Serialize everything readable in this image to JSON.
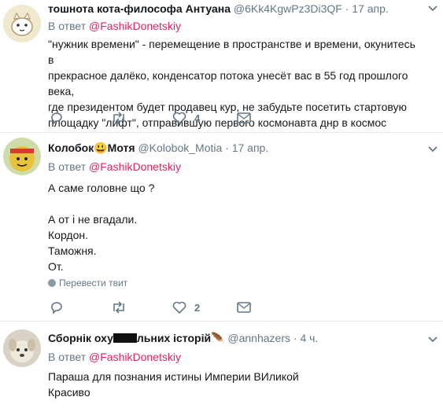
{
  "tweets": [
    {
      "name": "тошнота кота-философа Антуана",
      "handle": "@6Kk4KgwPz3Di3QF",
      "time": "17 апр.",
      "reply_prefix": "В ответ",
      "reply_mention": "@FashikDonetskiy",
      "text": "\"нужник времени\" - перемещение в пространстве и времени, окунитесь в\nпрекрасное далёко, конденсатор потока унесёт вас в 55 год прошлого века,\nгде президентом будет продавец кур, не забудьте посетить стартовую\nплощадку \"лифт\", отправившую первого космонавта днр в космос",
      "like_count": "4"
    },
    {
      "name_part1": "Колобок",
      "name_emoji": "😃",
      "name_part2": "Мотя",
      "handle": "@Kolobok_Motia",
      "time": "17 апр.",
      "reply_prefix": "В ответ",
      "reply_mention": "@FashikDonetskiy",
      "text": "А саме головне що ?\n\nА от і не вгадали.\nКордон.\nТаможня.\nОт.",
      "translate_label": "Перевести твит",
      "like_count": "2"
    },
    {
      "name_part1": "Сборнік оху",
      "name_part2": "льних історій",
      "name_emoji": "🪶",
      "handle": "@annhazers",
      "time": "4 ч.",
      "reply_prefix": "В ответ",
      "reply_mention": "@FashikDonetskiy",
      "text": "Параша для познания истины Империи ВИликой\nКрасиво"
    }
  ],
  "separator": "·",
  "colors": {
    "mention": "#e0245e",
    "secondary": "#657786",
    "text": "#14171a"
  }
}
